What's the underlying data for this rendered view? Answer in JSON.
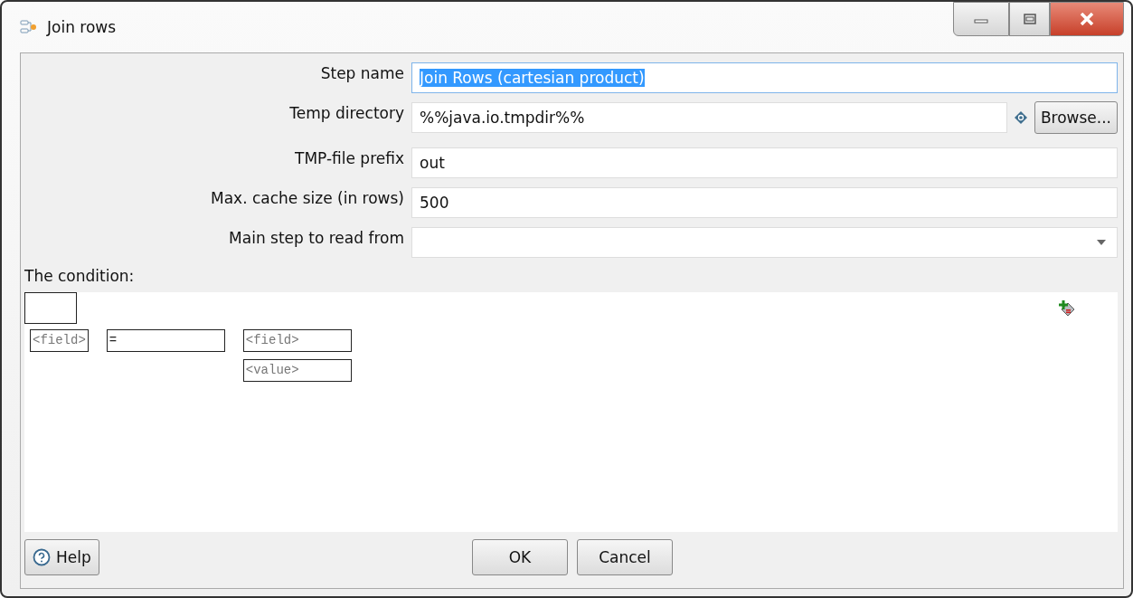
{
  "window": {
    "title": "Join rows"
  },
  "fields": [
    {
      "kind": "text",
      "label": "Step name",
      "value": "Join Rows (cartesian product)",
      "text_selected": true
    },
    {
      "kind": "browse",
      "label": "Temp directory",
      "value": "%%java.io.tmpdir%%",
      "button": "Browse..."
    },
    {
      "kind": "text",
      "label": "TMP-file prefix",
      "value": "out",
      "text_selected": false
    },
    {
      "kind": "text",
      "label": "Max. cache size (in rows)",
      "value": "500",
      "text_selected": false
    },
    {
      "kind": "dropdown",
      "label": "Main step to read from"
    }
  ],
  "condition": {
    "label": "The condition:",
    "left_field": "<field>",
    "operator": "=",
    "right_field": "<field>",
    "right_value": "<value>"
  },
  "buttons": {
    "help": "Help",
    "ok": "OK",
    "cancel": "Cancel"
  }
}
